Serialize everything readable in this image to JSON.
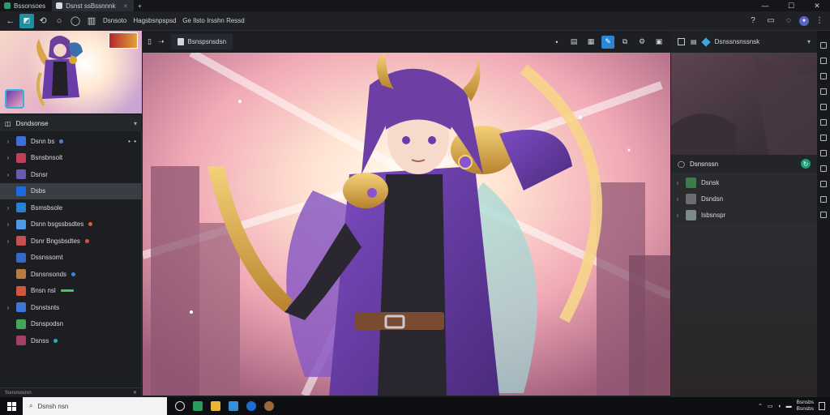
{
  "window": {
    "tabs": [
      {
        "label": "Bssonsoes",
        "icon": "app-icon",
        "color": "#2b9a6e"
      },
      {
        "label": "Dsnst ssBssnnnk",
        "icon": "document-icon",
        "color": "#d9dce2"
      }
    ],
    "controls": {
      "minimize": "—",
      "maximize": "☐",
      "close": "✕"
    }
  },
  "toolbar": {
    "back": "←",
    "items": [
      "Dsnsoto",
      "Hagsbsnpspsd",
      "Ge Ilsto Irsshn Ressd"
    ],
    "icons": [
      "undo-icon",
      "circle-icon",
      "circle-icon",
      "panels-icon"
    ]
  },
  "left_panel": {
    "header": "Dsndsonse",
    "layers": [
      {
        "label": "Dsnn bs",
        "arrow": "›",
        "thumb": "#3f6fd6",
        "badge": "#5b7bd8",
        "extra": "• •"
      },
      {
        "label": "Bsnsbnsolt",
        "arrow": "›",
        "thumb": "#c0405a"
      },
      {
        "label": "Dsnsr",
        "arrow": "›",
        "thumb": "#6a5ab3"
      },
      {
        "label": "Dsbs",
        "arrow": "",
        "thumb": "#1e6ae0",
        "selected": true
      },
      {
        "label": "Bsmsbsole",
        "arrow": "›",
        "thumb": "#2b7fd0"
      },
      {
        "label": "Dsnn bsgssbsdtes",
        "arrow": "›",
        "thumb": "#4d9be6",
        "badge": "#e05d3a"
      },
      {
        "label": "Dsnr Bngsbsdtes",
        "arrow": "›",
        "thumb": "#c65050",
        "badge": "#e84a3c"
      },
      {
        "label": "Dssnssomt",
        "arrow": "",
        "thumb": "#356ac9"
      },
      {
        "label": "Dsnsnsonds",
        "arrow": "",
        "thumb": "#b77c3f",
        "badge": "#3d86d6"
      },
      {
        "label": "Bnsn nsl",
        "arrow": "",
        "thumb": "#d2563c",
        "bar": true
      },
      {
        "label": "Dsnstsnts",
        "arrow": "›",
        "thumb": "#3d77d8"
      },
      {
        "label": "Dsnspodsn",
        "arrow": "",
        "thumb": "#46a35c"
      },
      {
        "label": "Dsnss",
        "arrow": "",
        "thumb": "#a53f65",
        "badge": "#35a6c9"
      }
    ],
    "footer": "Ssnsnusosn"
  },
  "canvas": {
    "tab_label": "Bsnspsnsdsn",
    "tools": [
      "pen-icon",
      "layers-icon",
      "edit-icon",
      "stack-icon",
      "settings-icon",
      "grid-icon"
    ],
    "active_tool": "edit-icon"
  },
  "right_panel": {
    "title": "Dsnssnsnssnsk",
    "section": "Dsnsnssn",
    "items": [
      {
        "label": "Dsnsk",
        "color": "#3f7a4a"
      },
      {
        "label": "Dsndsn",
        "color": "#6a6c70"
      },
      {
        "label": "Isbsnspr",
        "color": "#7a8a88"
      }
    ]
  },
  "taskbar": {
    "search_placeholder": "Dsnsh nsn",
    "tray": {
      "time": "Bsnsbs",
      "date": "Bsnsbs"
    },
    "apps": [
      "task-view-icon",
      "browser-icon",
      "files-icon",
      "store-icon",
      "edge-icon",
      "app-icon"
    ]
  },
  "colors": {
    "accent": "#2b86d6",
    "brand": "#1c8fa0",
    "ok": "#1f9d74"
  }
}
